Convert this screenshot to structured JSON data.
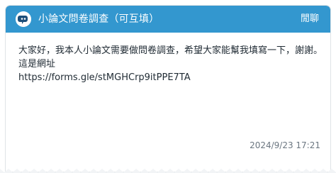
{
  "header": {
    "title": "小論文問卷調查（可互填）",
    "board_name": "閒聊",
    "logo_icon": "board-avatar-icon",
    "color": "#3397cf"
  },
  "post": {
    "line1": "大家好，我本人小論文需要做問卷調查，希望大家能幫我填寫一下，謝謝。",
    "line2": "這是網址",
    "link": "https://forms.gle/stMGHCrp9itPPE7TA",
    "timestamp": "2024/9/23 17:21"
  }
}
